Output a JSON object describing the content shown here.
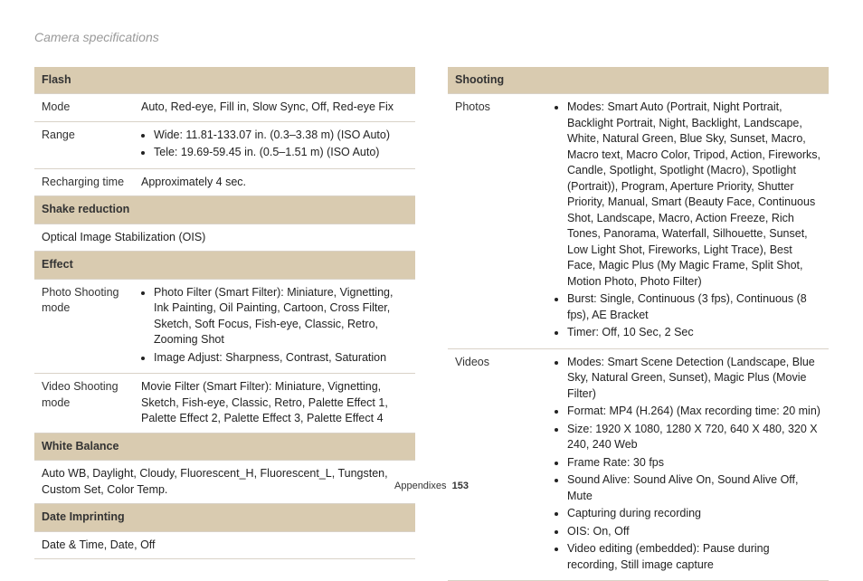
{
  "title": "Camera specifications",
  "left": {
    "flash_hd": "Flash",
    "flash_mode_lbl": "Mode",
    "flash_mode_val": "Auto, Red-eye, Fill in, Slow Sync, Off, Red-eye Fix",
    "flash_range_lbl": "Range",
    "flash_range_b1": "Wide: 11.81-133.07 in. (0.3–3.38 m) (ISO Auto)",
    "flash_range_b2": "Tele: 19.69-59.45 in. (0.5–1.51 m) (ISO Auto)",
    "flash_rech_lbl": "Recharging time",
    "flash_rech_val": "Approximately 4 sec.",
    "shake_hd": "Shake reduction",
    "shake_val": "Optical Image Stabilization (OIS)",
    "effect_hd": "Effect",
    "effect_photo_lbl": "Photo Shooting mode",
    "effect_photo_b1": "Photo Filter (Smart Filter): Miniature, Vignetting, Ink Painting, Oil Painting, Cartoon, Cross Filter, Sketch, Soft Focus, Fish-eye, Classic, Retro, Zooming Shot",
    "effect_photo_b2": "Image Adjust: Sharpness, Contrast, Saturation",
    "effect_video_lbl": "Video Shooting mode",
    "effect_video_val": "Movie Filter (Smart Filter): Miniature, Vignetting, Sketch, Fish-eye, Classic, Retro, Palette Effect 1, Palette Effect 2, Palette Effect 3, Palette Effect 4",
    "wb_hd": "White Balance",
    "wb_val": "Auto WB, Daylight, Cloudy, Fluorescent_H, Fluorescent_L, Tungsten, Custom Set, Color Temp.",
    "date_hd": "Date Imprinting",
    "date_val": "Date & Time, Date, Off"
  },
  "right": {
    "shooting_hd": "Shooting",
    "photos_lbl": "Photos",
    "photos_b1": "Modes: Smart Auto (Portrait, Night Portrait, Backlight Portrait, Night, Backlight, Landscape, White, Natural Green, Blue Sky, Sunset, Macro, Macro text, Macro Color, Tripod, Action, Fireworks, Candle, Spotlight, Spotlight (Macro), Spotlight (Portrait)), Program, Aperture Priority, Shutter Priority, Manual, Smart (Beauty Face, Continuous Shot, Landscape, Macro, Action Freeze, Rich Tones, Panorama, Waterfall, Silhouette, Sunset, Low Light Shot, Fireworks, Light Trace), Best Face, Magic Plus (My Magic Frame, Split Shot, Motion Photo, Photo Filter)",
    "photos_b2": "Burst: Single, Continuous (3 fps), Continuous (8 fps), AE Bracket",
    "photos_b3": "Timer: Off, 10 Sec, 2 Sec",
    "videos_lbl": "Videos",
    "videos_b1": "Modes: Smart Scene Detection (Landscape, Blue Sky, Natural Green, Sunset), Magic Plus (Movie Filter)",
    "videos_b2": "Format: MP4 (H.264) (Max recording time: 20 min)",
    "videos_b3": "Size: 1920 X 1080, 1280 X 720, 640 X 480, 320 X 240, 240 Web",
    "videos_b4": "Frame Rate: 30 fps",
    "videos_b5": "Sound Alive: Sound Alive On, Sound Alive Off, Mute",
    "videos_b6": "Capturing during recording",
    "videos_b7": "OIS: On, Off",
    "videos_b8": "Video editing (embedded): Pause during recording, Still image capture"
  },
  "footer_label": "Appendixes",
  "footer_page": "153"
}
